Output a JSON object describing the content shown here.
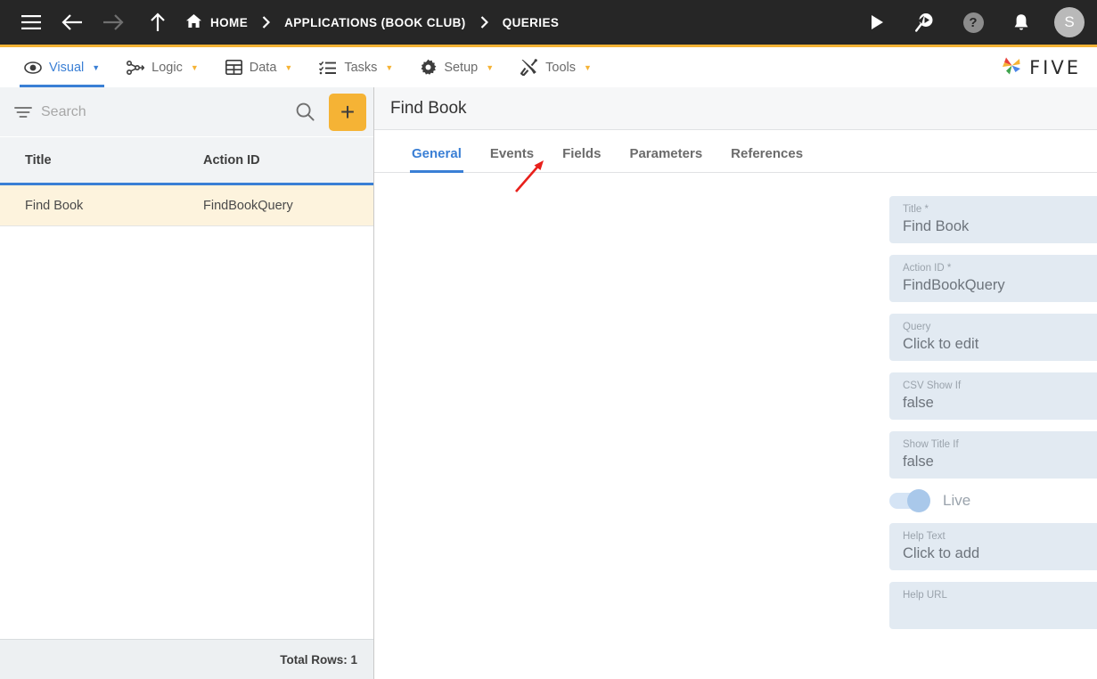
{
  "topbar": {
    "menu_icon": "hamburger-icon",
    "back_icon": "arrow-left-icon",
    "forward_icon": "arrow-right-icon",
    "up_icon": "arrow-up-icon",
    "breadcrumbs": [
      {
        "label": "HOME",
        "icon": "home-icon"
      },
      {
        "label": "APPLICATIONS (BOOK CLUB)",
        "icon": ""
      },
      {
        "label": "QUERIES",
        "icon": ""
      }
    ],
    "separator": "›",
    "actions": [
      {
        "name": "run-icon",
        "label": ""
      },
      {
        "name": "search-run-icon",
        "label": ""
      },
      {
        "name": "help-icon",
        "label": "?"
      },
      {
        "name": "notifications-bell-icon",
        "label": ""
      }
    ],
    "avatar_initial": "S"
  },
  "menubar": {
    "items": [
      {
        "label": "Visual",
        "icon": "eye-icon",
        "active": true
      },
      {
        "label": "Logic",
        "icon": "logic-nodes-icon",
        "active": false
      },
      {
        "label": "Data",
        "icon": "table-grid-icon",
        "active": false
      },
      {
        "label": "Tasks",
        "icon": "checklist-icon",
        "active": false
      },
      {
        "label": "Setup",
        "icon": "gear-icon",
        "active": false
      },
      {
        "label": "Tools",
        "icon": "tools-wrench-icon",
        "active": false
      }
    ],
    "caret": "▼",
    "brand": "FIVE"
  },
  "left_panel": {
    "search": {
      "placeholder": "Search",
      "value": ""
    },
    "filter_icon": "filter-icon",
    "search_icon": "search-icon",
    "add_button_label": "+",
    "columns": [
      "Title",
      "Action ID"
    ],
    "rows": [
      {
        "title": "Find Book",
        "action_id": "FindBookQuery",
        "selected": true
      }
    ],
    "footer": "Total Rows: 1"
  },
  "detail": {
    "title": "Find Book",
    "header_actions": [
      {
        "name": "history-clock-icon"
      },
      {
        "name": "edit-pencil-icon"
      },
      {
        "name": "back-arrow-icon"
      }
    ],
    "tabs": [
      {
        "label": "General",
        "active": true
      },
      {
        "label": "Events",
        "active": false
      },
      {
        "label": "Fields",
        "active": false
      },
      {
        "label": "Parameters",
        "active": false
      },
      {
        "label": "References",
        "active": false
      }
    ],
    "help_glyph": "?",
    "fields": [
      {
        "label": "Title *",
        "value": "Find Book"
      },
      {
        "label": "Action ID *",
        "value": "FindBookQuery"
      },
      {
        "label": "Query",
        "value": "Click to edit"
      },
      {
        "label": "CSV Show If",
        "value": "false"
      },
      {
        "label": "Show Title If",
        "value": "false"
      }
    ],
    "toggle": {
      "label": "Live",
      "on": true
    },
    "fields_after_toggle": [
      {
        "label": "Help Text",
        "value": "Click to add"
      },
      {
        "label": "Help URL",
        "value": ""
      }
    ]
  },
  "annotation": {
    "type": "red-arrow",
    "color": "#e8201b",
    "points_to": "Fields"
  },
  "colors": {
    "topbar_bg": "#262626",
    "accent_orange": "#f5b335",
    "accent_blue": "#3a7fd5",
    "field_bg": "#e2eaf2",
    "selected_row": "#fdf3dd"
  }
}
